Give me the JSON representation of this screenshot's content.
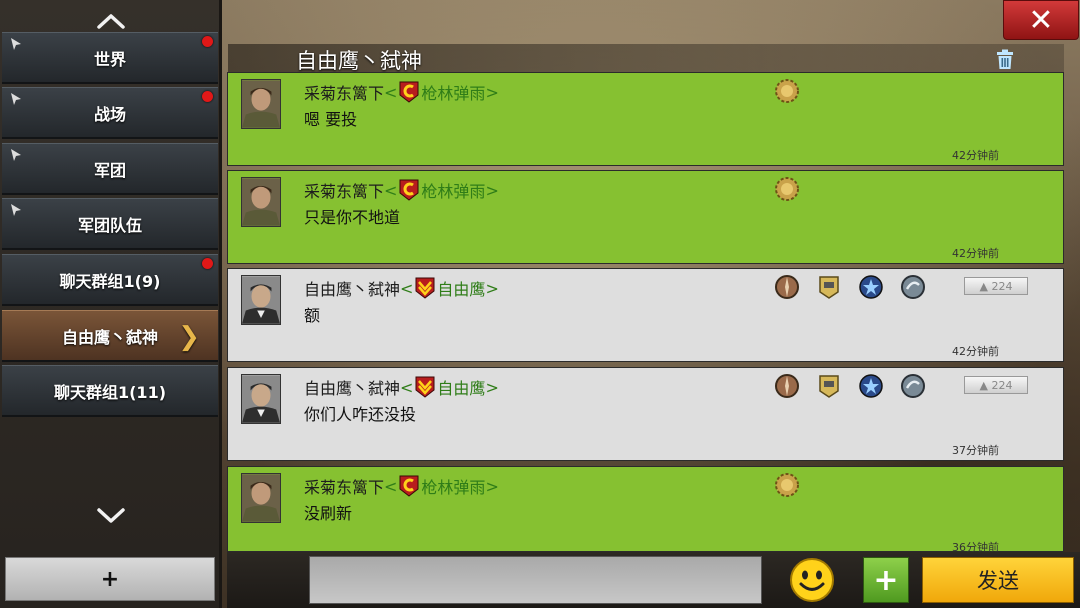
{
  "sidebar": {
    "channels": [
      {
        "label": "世界",
        "pinned": true,
        "unread": true
      },
      {
        "label": "战场",
        "pinned": true,
        "unread": true
      },
      {
        "label": "军团",
        "pinned": true,
        "unread": false
      },
      {
        "label": "军团队伍",
        "pinned": true,
        "unread": false
      },
      {
        "label": "聊天群组1(9)",
        "pinned": false,
        "unread": true
      },
      {
        "label": "自由鹰丶弑神",
        "pinned": false,
        "unread": false,
        "active": true
      },
      {
        "label": "聊天群组1(11)",
        "pinned": false,
        "unread": false
      }
    ],
    "add_label": "+"
  },
  "header": {
    "title": "自由鹰丶弑神",
    "close_label": "✕"
  },
  "messages": [
    {
      "name": "采菊东篱下",
      "guild": "枪林弹雨",
      "text": "嗯 要投",
      "time": "42分钟前",
      "style": "green"
    },
    {
      "name": "采菊东篱下",
      "guild": "枪林弹雨",
      "text": "只是你不地道",
      "time": "42分钟前",
      "style": "green"
    },
    {
      "name": "自由鹰丶弑神",
      "guild": "自由鹰",
      "text": "额",
      "time": "42分钟前",
      "style": "grey",
      "power": "224"
    },
    {
      "name": "自由鹰丶弑神",
      "guild": "自由鹰",
      "text": "你们人咋还没投",
      "time": "37分钟前",
      "style": "grey",
      "power": "224"
    },
    {
      "name": "采菊东篱下",
      "guild": "枪林弹雨",
      "text": "没刷新",
      "time": "36分钟前",
      "style": "green"
    }
  ],
  "input": {
    "placeholder": ""
  },
  "buttons": {
    "plus": "+",
    "send": "发送"
  },
  "colors": {
    "green_msg": "#86c131",
    "grey_msg": "#dedede",
    "guild_green": "#2f7d18",
    "send": "#f6c226",
    "close": "#c42a2a"
  }
}
